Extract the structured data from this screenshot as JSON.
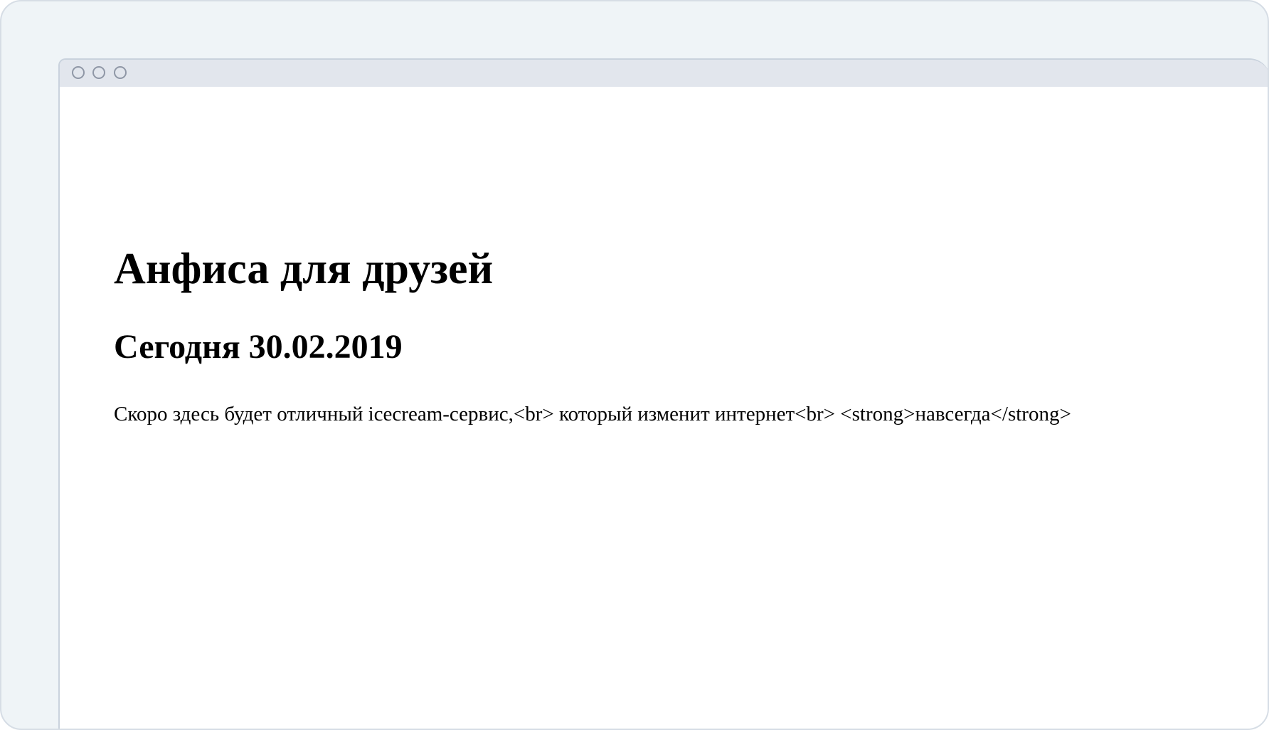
{
  "window": {
    "controls": [
      "window-control-1",
      "window-control-2",
      "window-control-3"
    ],
    "colors": {
      "frame_background": "#eff4f7",
      "titlebar_background": "#e2e6ed",
      "content_background": "#ffffff",
      "dot_border": "#8f97a6",
      "text": "#000000"
    }
  },
  "page": {
    "title": "Анфиса для друзей",
    "date_heading": "Сегодня 30.02.2019",
    "paragraph": "Скоро здесь будет отличный icecream-сервис,<br> который изменит интернет<br> <strong>навсегда</strong>"
  }
}
